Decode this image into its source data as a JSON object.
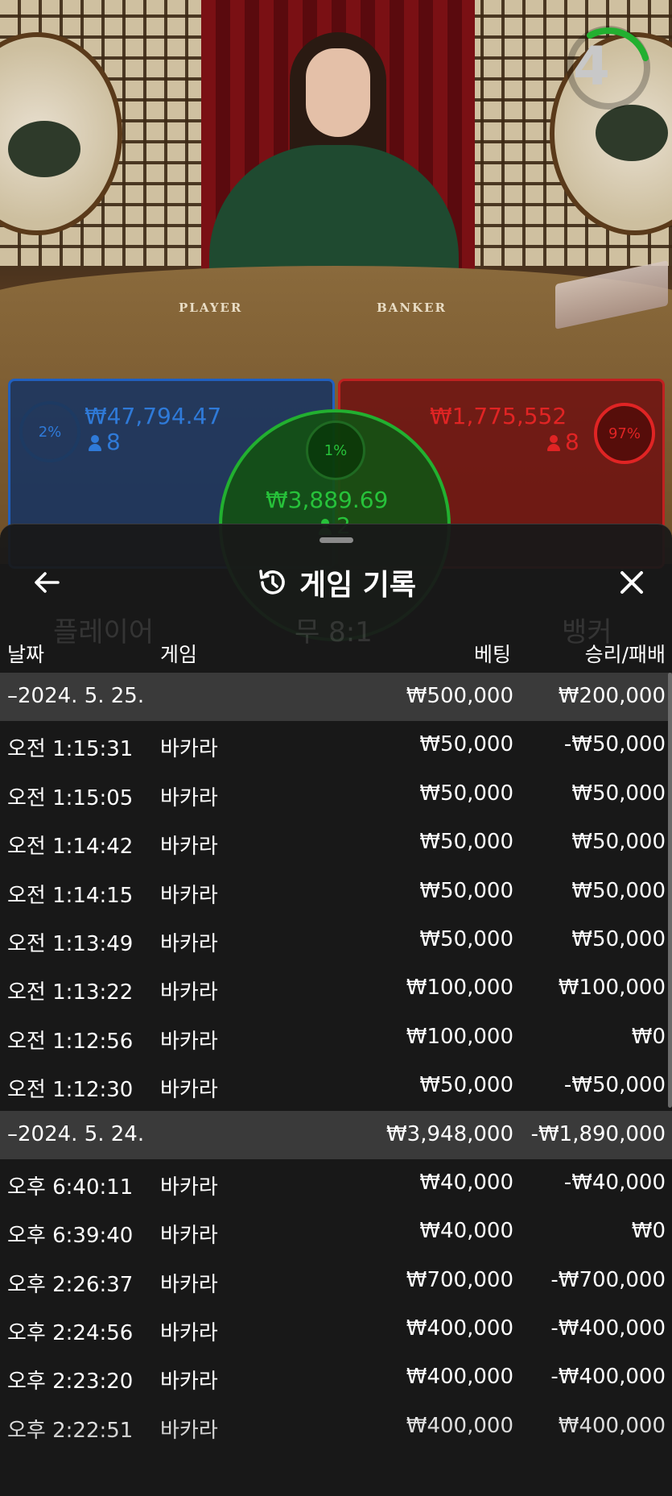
{
  "stream": {
    "timer_value": "4",
    "table_label_player": "PLAYER",
    "table_label_banker": "BANKER"
  },
  "bets": {
    "player": {
      "percent": "2%",
      "amount": "₩47,794.47",
      "count": "8",
      "ghost_label": "플레이어"
    },
    "tie": {
      "percent": "1%",
      "amount": "₩3,889.69",
      "count": "2",
      "ghost_label": "무 8:1"
    },
    "banker": {
      "percent": "97%",
      "amount": "₩1,775,552",
      "count": "8",
      "ghost_label": "뱅커"
    }
  },
  "history": {
    "title": "게임 기록",
    "columns": {
      "date": "날짜",
      "game": "게임",
      "bet": "베팅",
      "result": "승리/패배"
    },
    "rows": [
      {
        "type": "date",
        "time": "–2024. 5. 25.",
        "game": "",
        "bet": "₩500,000",
        "result": "₩200,000"
      },
      {
        "type": "game",
        "time": "오전 1:15:31",
        "game": "바카라",
        "bet": "₩50,000",
        "result": "-₩50,000"
      },
      {
        "type": "game",
        "time": "오전 1:15:05",
        "game": "바카라",
        "bet": "₩50,000",
        "result": "₩50,000"
      },
      {
        "type": "game",
        "time": "오전 1:14:42",
        "game": "바카라",
        "bet": "₩50,000",
        "result": "₩50,000"
      },
      {
        "type": "game",
        "time": "오전 1:14:15",
        "game": "바카라",
        "bet": "₩50,000",
        "result": "₩50,000"
      },
      {
        "type": "game",
        "time": "오전 1:13:49",
        "game": "바카라",
        "bet": "₩50,000",
        "result": "₩50,000"
      },
      {
        "type": "game",
        "time": "오전 1:13:22",
        "game": "바카라",
        "bet": "₩100,000",
        "result": "₩100,000"
      },
      {
        "type": "game",
        "time": "오전 1:12:56",
        "game": "바카라",
        "bet": "₩100,000",
        "result": "₩0"
      },
      {
        "type": "game",
        "time": "오전 1:12:30",
        "game": "바카라",
        "bet": "₩50,000",
        "result": "-₩50,000"
      },
      {
        "type": "date",
        "time": "–2024. 5. 24.",
        "game": "",
        "bet": "₩3,948,000",
        "result": "-₩1,890,000"
      },
      {
        "type": "game",
        "time": "오후 6:40:11",
        "game": "바카라",
        "bet": "₩40,000",
        "result": "-₩40,000"
      },
      {
        "type": "game",
        "time": "오후 6:39:40",
        "game": "바카라",
        "bet": "₩40,000",
        "result": "₩0"
      },
      {
        "type": "game",
        "time": "오후 2:26:37",
        "game": "바카라",
        "bet": "₩700,000",
        "result": "-₩700,000"
      },
      {
        "type": "game",
        "time": "오후 2:24:56",
        "game": "바카라",
        "bet": "₩400,000",
        "result": "-₩400,000"
      },
      {
        "type": "game",
        "time": "오후 2:23:20",
        "game": "바카라",
        "bet": "₩400,000",
        "result": "-₩400,000"
      },
      {
        "type": "game",
        "time": "오후 2:22:51",
        "game": "바카라",
        "bet": "₩400,000",
        "result": "₩400,000"
      }
    ]
  },
  "colors": {
    "player_blue": "#2f7ad8",
    "banker_red": "#e02424",
    "tie_green": "#27c23a",
    "date_row_bg": "#3a3a3a",
    "timer_green": "#22b030"
  },
  "icons": {
    "back": "arrow-left-icon",
    "history": "history-clock-icon",
    "close": "close-icon",
    "person": "person-icon"
  }
}
